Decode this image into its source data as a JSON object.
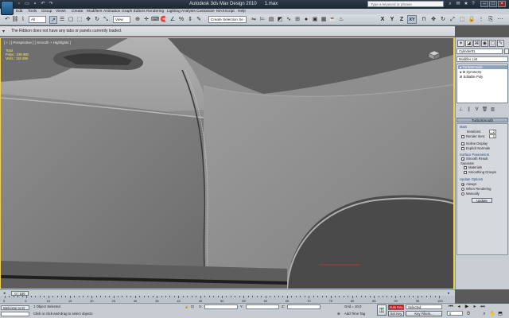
{
  "window": {
    "title": "Autodesk 3ds Max Design 2010",
    "file": "1.max",
    "search_placeholder": "Type a keyword or phrase"
  },
  "menu": [
    "Edit",
    "Tools",
    "Group",
    "Views",
    "Create",
    "Modifiers",
    "Animation",
    "Graph Editors",
    "Rendering",
    "Lighting Analysis",
    "Customize",
    "MAXScript",
    "Help"
  ],
  "toolbar": {
    "selection_filter": "All",
    "ref_coord": "View",
    "named_selection": "Create Selection Se",
    "axis": [
      "X",
      "Y",
      "Z",
      "XY"
    ]
  },
  "ribbon": {
    "notice": "The Ribbon does not have any tabs or panels currently loaded."
  },
  "viewport": {
    "label": "[ + ] [ Perspective ] [ Smooth + Highlights ]",
    "stats_title": "Total",
    "polys_label": "Polys :",
    "polys_value": "235 980",
    "verts_label": "Verts :",
    "verts_value": "118 289"
  },
  "command_panel": {
    "object_name": "Cylinder01",
    "modifier_list": "Modifier List",
    "stack": [
      "TurboSmooth",
      "Symmetry",
      "Editable Poly"
    ],
    "rollout_title": "TurboSmooth",
    "main_label": "Main",
    "iterations_label": "Iterations:",
    "iterations_value": "2",
    "render_iters_label": "Render Iters:",
    "render_iters_value": "0",
    "isoline_display": "Isoline Display",
    "explicit_normals": "Explicit Normals",
    "surface_params": "Surface Parameters",
    "smooth_result": "Smooth Result",
    "separate": "Separate",
    "materials": "Materials",
    "smoothing_groups": "Smoothing Groups",
    "update_options": "Update Options",
    "always": "Always",
    "when_rendering": "When Rendering",
    "manually": "Manually",
    "update_button": "Update"
  },
  "timeline": {
    "frame_display": "0 / 100",
    "ticks": [
      "0",
      "5",
      "10",
      "15",
      "20",
      "25",
      "30",
      "35",
      "40",
      "45",
      "50",
      "55",
      "60",
      "65",
      "70",
      "75",
      "80",
      "85",
      "90",
      "95",
      "100"
    ]
  },
  "status": {
    "welcome": "Welcome to M",
    "selected": "1 Object Selected",
    "prompt": "Click or click-and-drag to select objects",
    "x_label": "X:",
    "y_label": "Y:",
    "z_label": "Z:",
    "grid": "Grid = 10,0",
    "add_time_tag": "Add Time Tag",
    "auto_key": "Auto Key",
    "set_key": "Set Key",
    "key_mode": "Selected",
    "key_filters": "Key Filters...",
    "frame": "0"
  },
  "colors": {
    "active_border": "#f0d24a",
    "stats_text": "#ffe96b",
    "stack_selected": "#8ea4bd"
  }
}
